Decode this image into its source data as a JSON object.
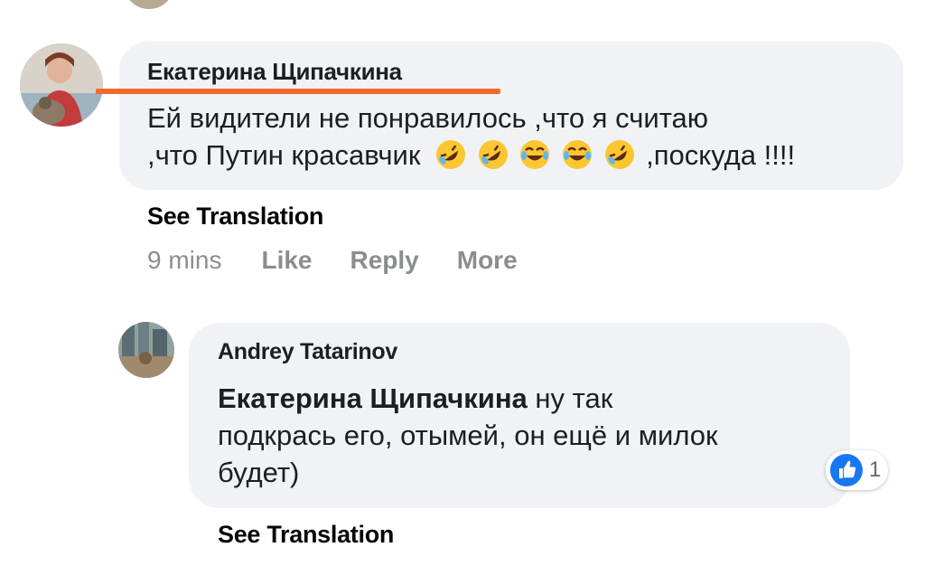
{
  "comment": {
    "author": "Екатерина Щипачкина",
    "text_line1": "Ей видители не понравилось ,что я считаю",
    "text_line2_pre": ",что Путин красавчик",
    "text_line2_post": ",поскуда !!!!",
    "emojis": [
      "rolling-on-floor-laughing",
      "rolling-on-floor-laughing",
      "face-with-tears-of-joy",
      "face-with-tears-of-joy",
      "rolling-on-floor-laughing"
    ],
    "see_translation": "See Translation",
    "time": "9 mins",
    "like": "Like",
    "reply": "Reply",
    "more": "More"
  },
  "reply": {
    "author": "Andrey Tatarinov",
    "mention": "Екатерина Щипачкина",
    "text_line1": " ну так",
    "text_line2": "подкрась его, отымей, он ещё и милок",
    "text_line3": "будет)",
    "reaction_count": "1",
    "see_translation": "See Translation"
  },
  "colors": {
    "bubble": "#f0f2f5",
    "annotation_underline": "#f26a2b",
    "like_blue": "#1877f2",
    "muted": "#8a8d91"
  }
}
